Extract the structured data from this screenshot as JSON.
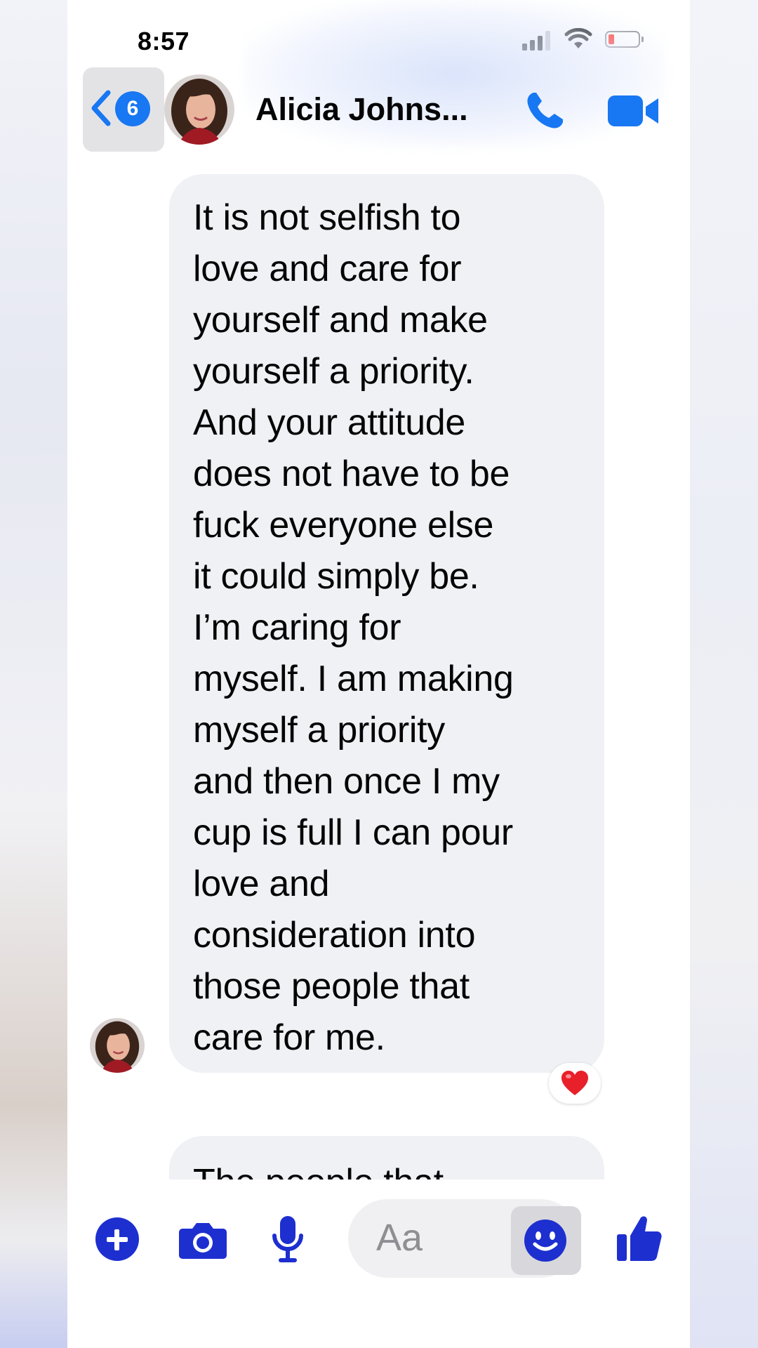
{
  "status_bar": {
    "time": "8:57"
  },
  "header": {
    "back_badge_count": "6",
    "contact_name": "Alicia Johns...",
    "icons": [
      "back-chevron-icon",
      "phone-call-icon",
      "video-call-icon"
    ]
  },
  "messages": [
    {
      "lines": [
        "It is not selfish to",
        "love and care for",
        "yourself and make",
        "yourself a priority.",
        "And your attitude",
        "does not have to be",
        "fuck everyone else",
        "it could simply be.",
        "I’m caring for",
        "myself. I am making",
        "myself a priority",
        "and then once I my",
        "cup is full I can pour",
        "love and",
        "consideration into",
        "those people that",
        "care for me."
      ],
      "reaction": "❤️"
    },
    {
      "lines": [
        "The people that"
      ]
    }
  ],
  "composer": {
    "placeholder": "Aa",
    "icons": [
      "add-plus-icon",
      "camera-icon",
      "microphone-icon",
      "emoji-icon",
      "thumbs-up-icon"
    ]
  },
  "colors": {
    "accent": "#1e2fd0",
    "bubble_bg": "#f0f1f5",
    "badge": "#1877f2"
  }
}
